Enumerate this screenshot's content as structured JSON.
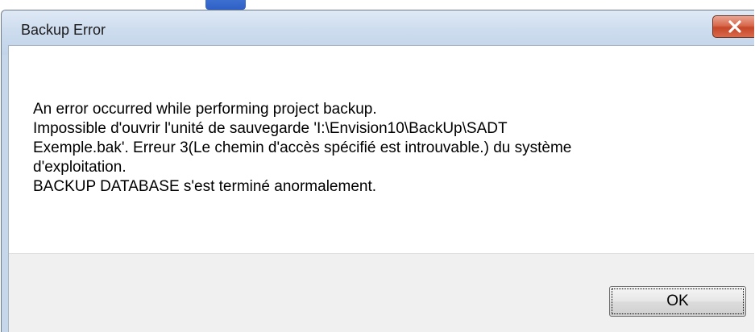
{
  "window": {
    "title": "Backup Error",
    "close_icon": "close-icon"
  },
  "message": {
    "lines": [
      "An error occurred while performing project backup.",
      "Impossible d'ouvrir l'unité de sauvegarde 'I:\\Envision10\\BackUp\\SADT",
      "Exemple.bak'. Erreur 3(Le chemin d'accès spécifié est introuvable.) du système",
      "d'exploitation.",
      "BACKUP DATABASE s'est terminé anormalement."
    ]
  },
  "buttons": {
    "ok_label": "OK"
  },
  "colors": {
    "titlebar": "#c6d7ec",
    "close_button": "#c6472a",
    "footer": "#f0f0f0",
    "content": "#ffffff"
  }
}
